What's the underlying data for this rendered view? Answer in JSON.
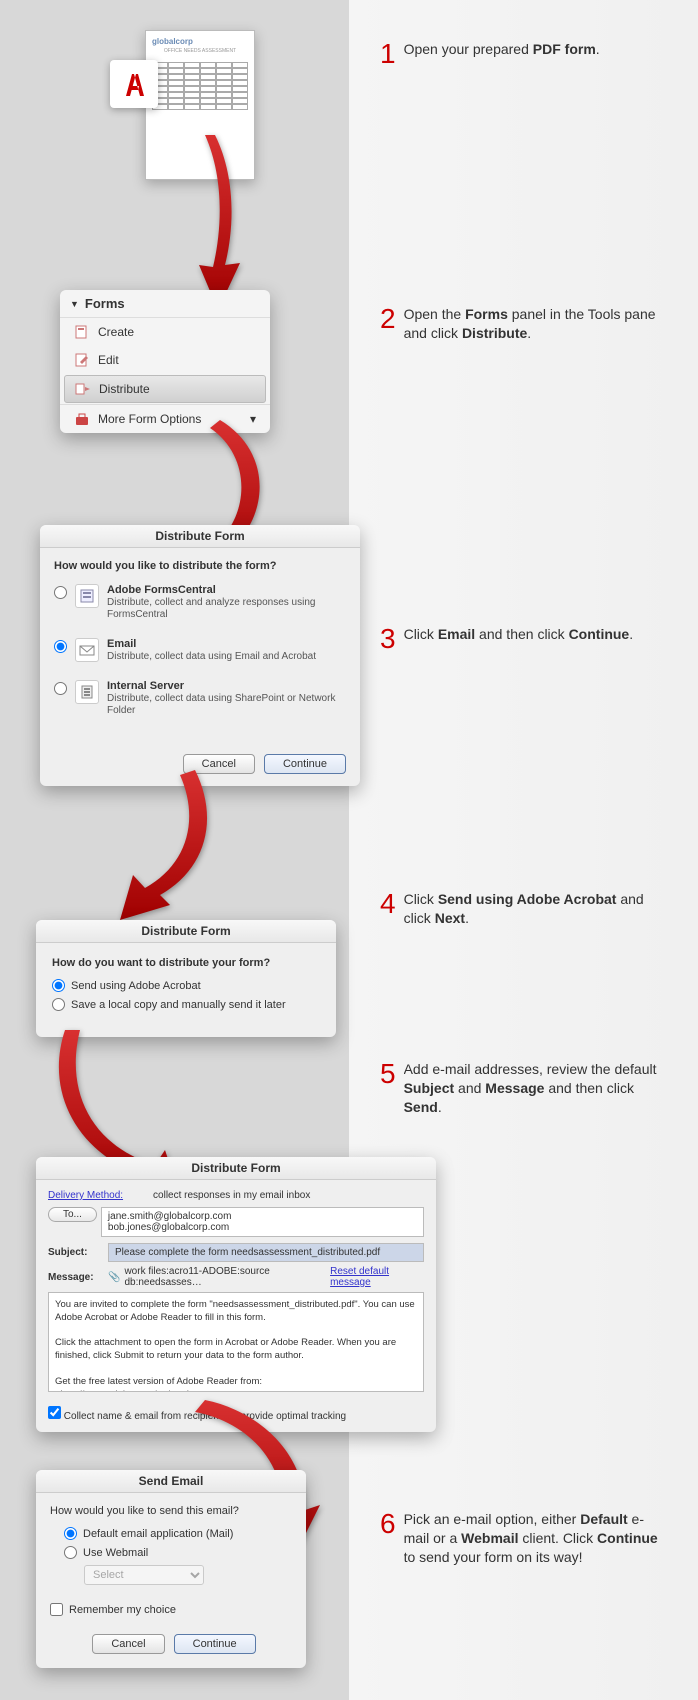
{
  "steps": {
    "s1": {
      "num": "1",
      "t1": "Open your prepared ",
      "b1": "PDF form",
      "t2": "."
    },
    "s2": {
      "num": "2",
      "t1": "Open the ",
      "b1": "Forms",
      "t2": " panel in the Tools pane and click ",
      "b2": "Distribute",
      "t3": "."
    },
    "s3": {
      "num": "3",
      "t1": "Click ",
      "b1": "Email",
      "t2": " and then click ",
      "b2": "Continue",
      "t3": "."
    },
    "s4": {
      "num": "4",
      "t1": "Click ",
      "b1": "Send using Adobe Acrobat",
      "t2": " and click ",
      "b2": "Next",
      "t3": "."
    },
    "s5": {
      "num": "5",
      "t1": "Add e-mail addresses, review the default ",
      "b1": "Subject",
      "t2": " and ",
      "b2": "Message",
      "t3": " and then click ",
      "b3": "Send",
      "t4": "."
    },
    "s6": {
      "num": "6",
      "t1": "Pick an e-mail option, either ",
      "b1": "Default",
      "t2": " e-mail or a ",
      "b2": "Webmail",
      "t3": " client. Click ",
      "b3": "Continue",
      "t4": " to send your form on its way!"
    }
  },
  "pdfdoc": {
    "brand": "globalcorp",
    "title": "OFFICE NEEDS ASSESSMENT"
  },
  "forms_panel": {
    "header": "Forms",
    "create": "Create",
    "edit": "Edit",
    "distribute": "Distribute",
    "more": "More Form Options"
  },
  "dist1": {
    "title": "Distribute Form",
    "q": "How would you like to distribute the form?",
    "opt1": {
      "title": "Adobe FormsCentral",
      "sub": "Distribute, collect and analyze responses using FormsCentral"
    },
    "opt2": {
      "title": "Email",
      "sub": "Distribute, collect data using Email and Acrobat"
    },
    "opt3": {
      "title": "Internal Server",
      "sub": "Distribute, collect data using SharePoint or Network Folder"
    },
    "cancel": "Cancel",
    "cont": "Continue"
  },
  "dist2": {
    "title": "Distribute Form",
    "q": "How do you want to distribute your form?",
    "opt1": "Send using Adobe Acrobat",
    "opt2": "Save a local copy and manually send it later"
  },
  "dist3": {
    "title": "Distribute Form",
    "delivery": "Delivery Method:",
    "collect": "collect responses in my email inbox",
    "to": "To...",
    "addr1": "jane.smith@globalcorp.com",
    "addr2": "bob.jones@globalcorp.com",
    "subject_lbl": "Subject:",
    "subject": "Please complete the form needsassessment_distributed.pdf",
    "message_lbl": "Message:",
    "attach": "work files:acro11-ADOBE:source db:needsasses…",
    "reset": "Reset default message",
    "msg1": "You are invited to complete the form \"needsassessment_distributed.pdf\". You can use Adobe Acrobat or Adobe Reader to fill in this form.",
    "msg2": "Click the attachment to open the form in Acrobat or Adobe Reader. When you are finished, click Submit to return your data to the form author.",
    "msg3": "Get the free latest version of Adobe Reader from:",
    "msg4": "<http://www.adobe.com/go/reader>",
    "checkbox": "Collect name & email from recipients to provide optimal tracking"
  },
  "send": {
    "title": "Send Email",
    "q": "How would you like to send this email?",
    "opt1": "Default email application (Mail)",
    "opt2": "Use Webmail",
    "select": "Select",
    "remember": "Remember my choice",
    "cancel": "Cancel",
    "cont": "Continue"
  }
}
